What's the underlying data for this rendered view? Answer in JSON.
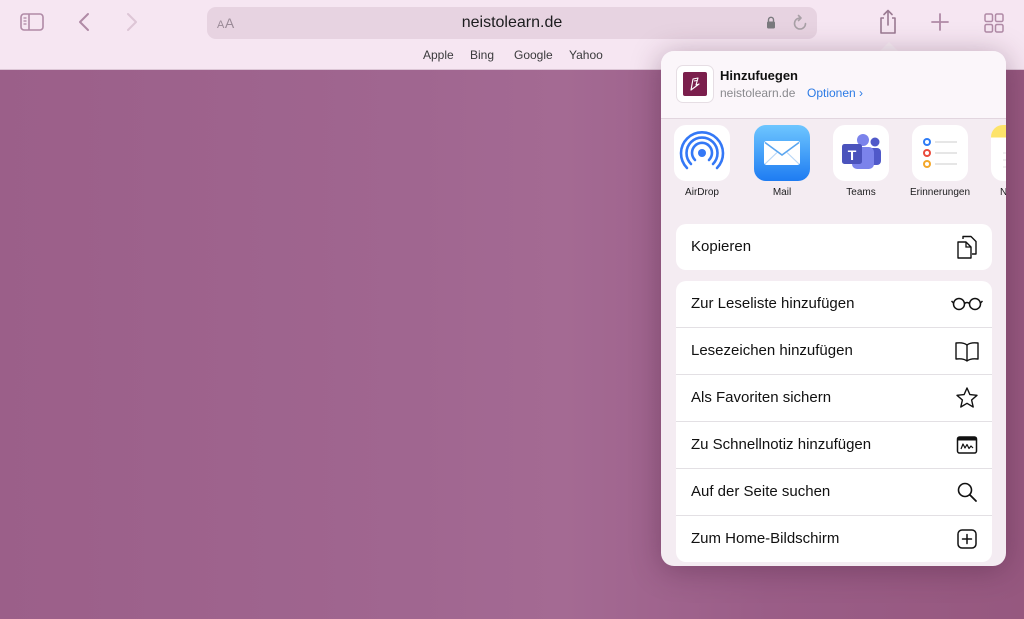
{
  "toolbar": {
    "text_size_label": "AA",
    "url_domain": "neistolearn.de",
    "icons": [
      "sidebar-icon",
      "back-icon",
      "forward-icon",
      "share-icon",
      "new-tab-icon",
      "tabs-overview-icon",
      "lock-icon",
      "reload-icon"
    ]
  },
  "favorites": [
    "Apple",
    "Bing",
    "Google",
    "Yahoo"
  ],
  "share_sheet": {
    "title": "Hinzufuegen",
    "domain": "neistolearn.de",
    "options_label": "Optionen ›",
    "apps": [
      {
        "label": "AirDrop",
        "icon": "airdrop-icon"
      },
      {
        "label": "Mail",
        "icon": "mail-icon"
      },
      {
        "label": "Teams",
        "icon": "teams-icon"
      },
      {
        "label": "Erinnerungen",
        "icon": "reminders-icon"
      },
      {
        "label": "N",
        "icon": "notes-icon"
      }
    ],
    "copy_action": {
      "label": "Kopieren",
      "icon": "copy-icon"
    },
    "actions": [
      {
        "label": "Zur Leseliste hinzufügen",
        "icon": "glasses-icon"
      },
      {
        "label": "Lesezeichen hinzufügen",
        "icon": "book-icon"
      },
      {
        "label": "Als Favoriten sichern",
        "icon": "star-icon"
      },
      {
        "label": "Zu Schnellnotiz hinzufügen",
        "icon": "quick-note-icon"
      },
      {
        "label": "Auf der Seite suchen",
        "icon": "search-icon"
      },
      {
        "label": "Zum Home-Bildschirm",
        "icon": "add-square-icon"
      }
    ]
  },
  "colors": {
    "page_background": "#a06690",
    "toolbar": "#f6e6f2",
    "accent_blue": "#2c7be5",
    "site_brand": "#7a1f4c"
  }
}
